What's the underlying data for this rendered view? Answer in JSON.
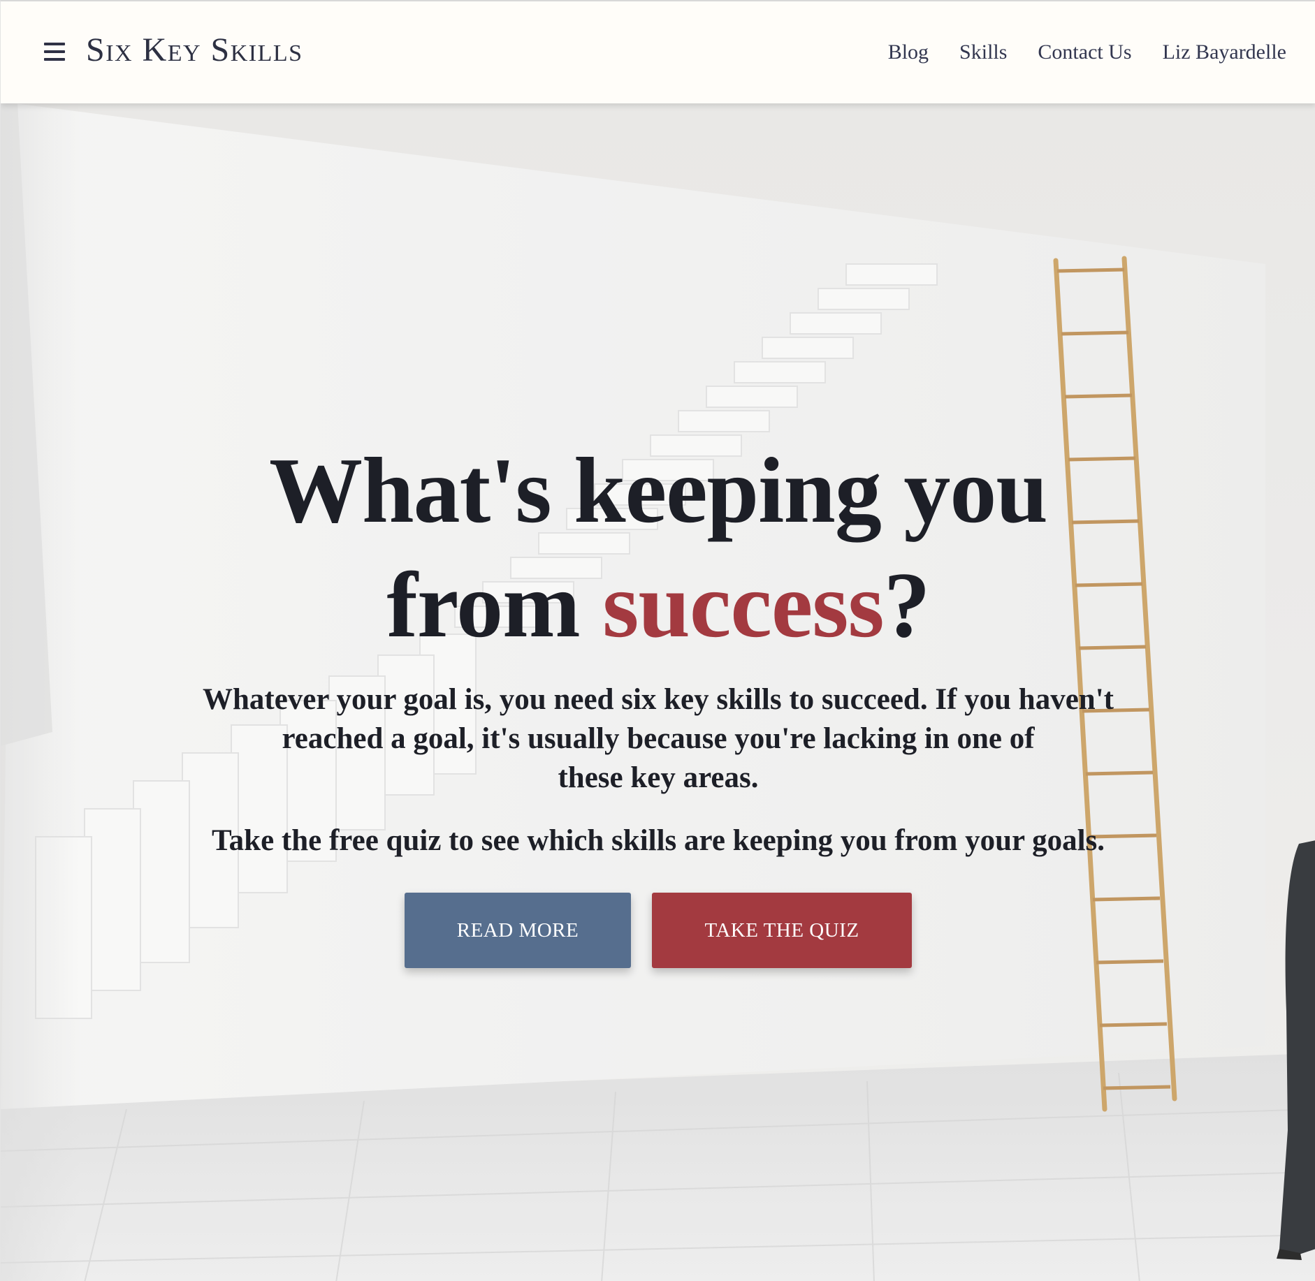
{
  "header": {
    "brand": "Six Key Skills",
    "nav": [
      "Blog",
      "Skills",
      "Contact Us",
      "Liz Bayardelle"
    ]
  },
  "hero": {
    "headline_part1": "What's keeping you",
    "headline_part2": "from ",
    "headline_accent": "success",
    "headline_end": "?",
    "subhead_lines": [
      "Whatever your goal is, you need six key skills to succeed. If you haven't",
      "reached a goal, it's usually because you're lacking in one of",
      "these key areas."
    ],
    "cta_text": "Take the free quiz to see which skills are keeping you from your goals.",
    "buttons": {
      "read_more": "READ MORE",
      "take_quiz": "TAKE THE QUIZ"
    }
  },
  "colors": {
    "accent_red": "#a33a40",
    "button_blue": "#566e8e",
    "brand_navy": "#2d3042",
    "header_bg": "#fffdf9"
  },
  "icons": {
    "menu": "hamburger-menu-icon"
  }
}
